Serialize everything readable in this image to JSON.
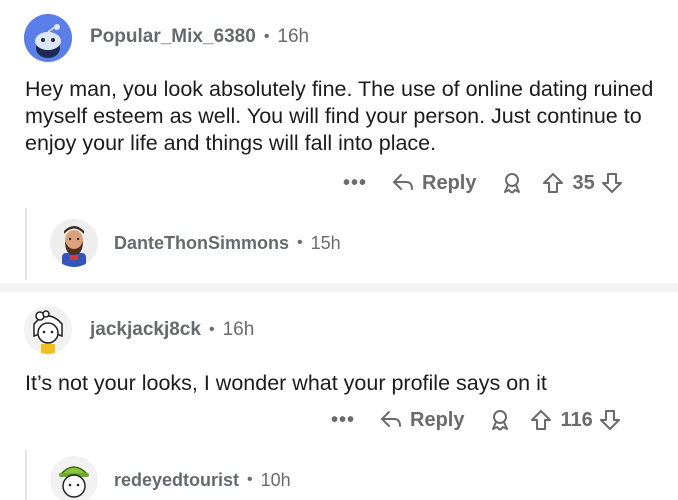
{
  "comments": [
    {
      "username": "Popular_Mix_6380",
      "time": "16h",
      "separator": "•",
      "body": "Hey man, you look absolutely fine. The use of online dating ruined myself esteem as well. You will find your person. Just continue to enjoy your life and things will fall into place.",
      "more_label": "•••",
      "reply_label": "Reply",
      "score": "35",
      "avatar_icon": "reddit-snoo-avatar",
      "reply": {
        "username": "DanteThonSimmons",
        "time": "15h",
        "separator": "•",
        "avatar_icon": "bearded-man-avatar"
      }
    },
    {
      "username": "jackjackj8ck",
      "time": "16h",
      "separator": "•",
      "body": "It’s not your looks, I wonder what your profile says on it",
      "more_label": "•••",
      "reply_label": "Reply",
      "score": "116",
      "avatar_icon": "bow-girl-avatar",
      "reply": {
        "username": "redeyedtourist",
        "time": "10h",
        "separator": "•",
        "avatar_icon": "green-cap-avatar"
      }
    }
  ],
  "colors": {
    "accent_snoo": "#5b7fe8",
    "meta_gray": "#6b6b6b",
    "separator_bg": "#f4f4f6"
  }
}
